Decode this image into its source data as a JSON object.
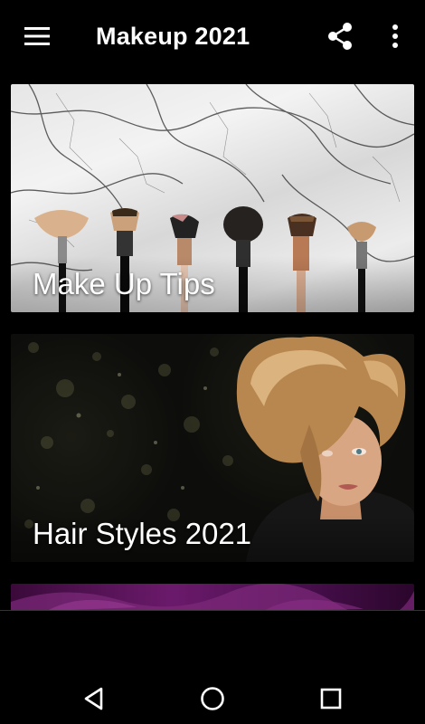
{
  "app_bar": {
    "title": "Makeup 2021",
    "icons": [
      "menu-icon",
      "share-icon",
      "more-vert-icon"
    ]
  },
  "cards": [
    {
      "title": "Make Up Tips",
      "image": "makeup-brushes-on-marble"
    },
    {
      "title": "Hair Styles 2021",
      "image": "woman-blonde-updo-hairstyle"
    },
    {
      "title": "",
      "image": "purple-petals-partial"
    }
  ],
  "nav_bar": {
    "icons": [
      "back-icon",
      "home-icon",
      "recents-icon"
    ]
  },
  "colors": {
    "background": "#000000",
    "text": "#ffffff"
  }
}
